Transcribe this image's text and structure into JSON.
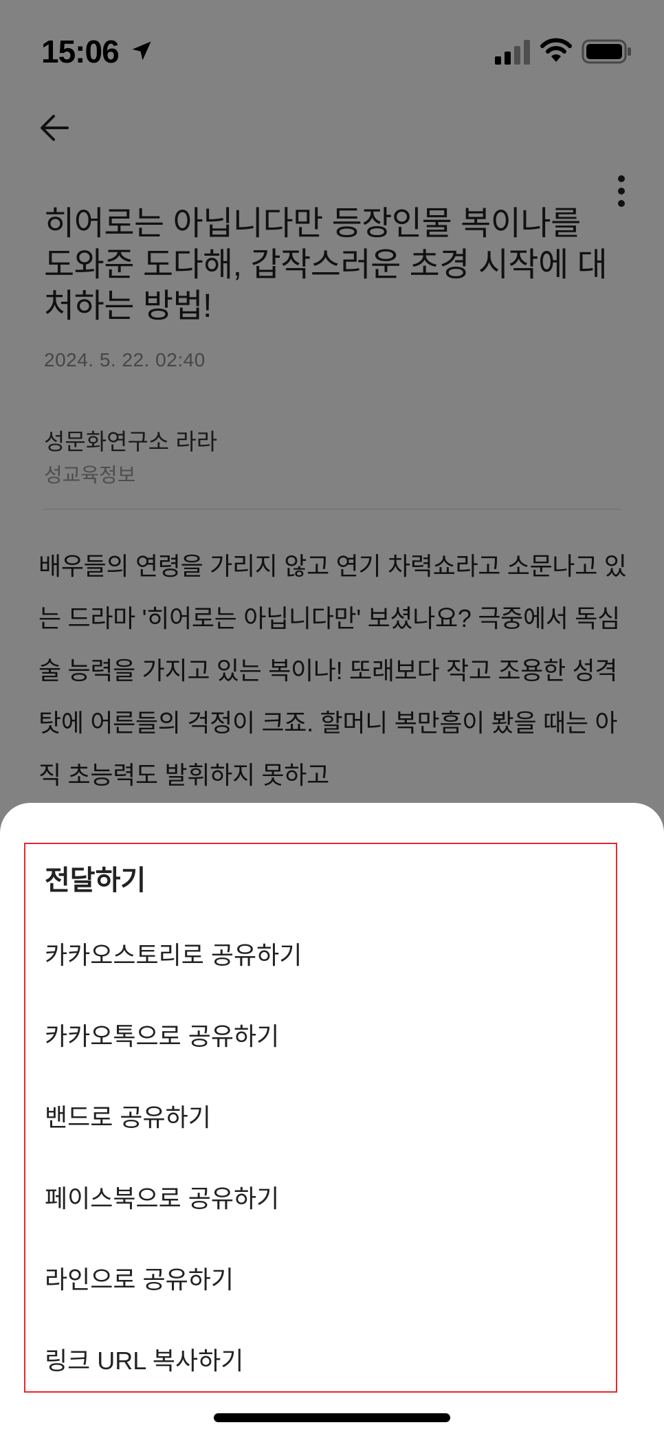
{
  "status_bar": {
    "time": "15:06",
    "icons": [
      "location-arrow-icon",
      "cellular-signal-icon",
      "wifi-icon",
      "battery-icon"
    ]
  },
  "header": {
    "back_icon": "arrow-left-icon",
    "more_icon": "vertical-dots-icon"
  },
  "article": {
    "title": "히어로는 아닙니다만 등장인물 복이나를 도와준 도다해, 갑작스러운 초경 시작에 대처하는 방법!",
    "date": "2024. 5. 22. 02:40",
    "author": "성문화연구소 라라",
    "category": "성교육정보",
    "body": "배우들의 연령을 가리지 않고 연기 차력쇼라고 소문나고 있는 드라마 '히어로는 아닙니다만' 보셨나요? 극중에서 독심술 능력을 가지고 있는 복이나! 또래보다 작고 조용한 성격 탓에 어른들의 걱정이 크죠. 할머니 복만흠이 봤을 때는 아직 초능력도 발휘하지 못하고"
  },
  "share_sheet": {
    "title": "전달하기",
    "items": [
      "카카오스토리로 공유하기",
      "카카오톡으로 공유하기",
      "밴드로 공유하기",
      "페이스북으로 공유하기",
      "라인으로 공유하기",
      "링크 URL 복사하기"
    ]
  },
  "colors": {
    "highlight_border": "#e8262c",
    "overlay": "rgba(0,0,0,0.49)",
    "text_primary": "#222222",
    "text_secondary": "#8a8a8a"
  }
}
